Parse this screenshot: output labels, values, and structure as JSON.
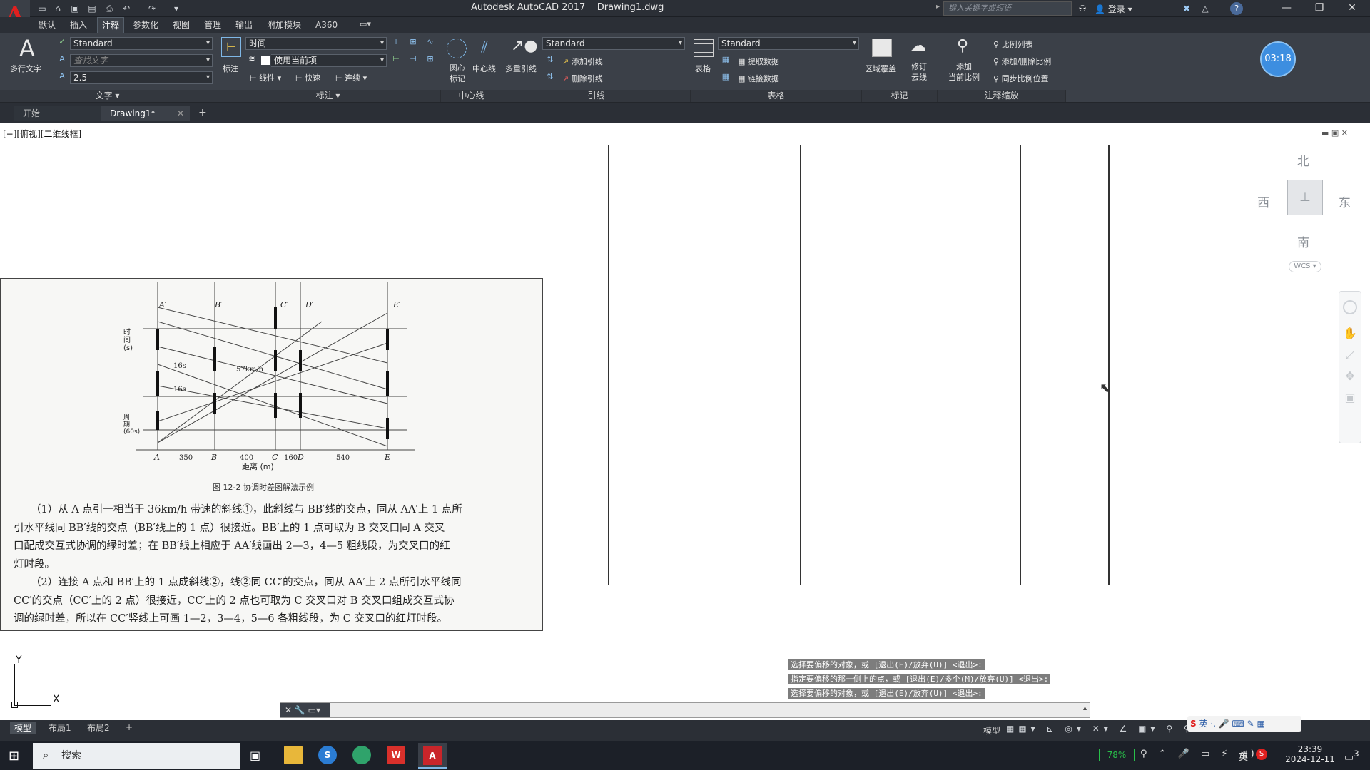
{
  "titlebar": {
    "app_name": "Autodesk AutoCAD 2017",
    "doc_name": "Drawing1.dwg",
    "search_placeholder": "键入关键字或短语",
    "login": "登录"
  },
  "menu_tabs": [
    "默认",
    "插入",
    "注释",
    "参数化",
    "视图",
    "管理",
    "输出",
    "附加模块",
    "A360"
  ],
  "active_menu_tab": "注释",
  "ribbon": {
    "text_panel": {
      "big_button": "多行文字",
      "style": "Standard",
      "find_placeholder": "查找文字",
      "height": "2.5",
      "title": "文字"
    },
    "dim_panel": {
      "big_button": "标注",
      "dim_style": "时间",
      "layer": "使用当前项",
      "linear": "线性",
      "quick": "快速",
      "continue": "连续",
      "title": "标注"
    },
    "centerline_panel": {
      "center_mark": "圆心\n标记",
      "centerline": "中心线",
      "title": "中心线"
    },
    "leader_panel": {
      "big_button": "多重引线",
      "style": "Standard",
      "add": "添加引线",
      "remove": "删除引线",
      "title": "引线"
    },
    "table_panel": {
      "big_button": "表格",
      "style": "Standard",
      "extract": "提取数据",
      "link": "链接数据",
      "title": "表格"
    },
    "markup_panel": {
      "wipeout": "区域覆盖",
      "revcloud": "修订\n云线",
      "title": "标记"
    },
    "scale_panel": {
      "add_scale": "添加\n当前比例",
      "scale_list": "比例列表",
      "add_delete": "添加/删除比例",
      "sync": "同步比例位置",
      "title": "注释缩放"
    },
    "timer": "03:18"
  },
  "doc_tabs": {
    "start": "开始",
    "drawing": "Drawing1*"
  },
  "viewport": {
    "label": "[−][俯视][二维线框]"
  },
  "viewcube": {
    "north": "北",
    "south": "南",
    "east": "东",
    "west": "西",
    "wcs": "WCS"
  },
  "ucs": {
    "x": "X",
    "y": "Y"
  },
  "image_text": {
    "fig_caption": "图 12-2   协调时差图解法示例",
    "y_axis": "时间(s)",
    "x_axis": "距离 (m)",
    "period": "周期(60s)",
    "p1": "（1）从 A 点引一相当于 36km/h 带速的斜线①，此斜线与 BB′线的交点，同从 AA′上 1 点所",
    "p2": "引水平线同 BB′线的交点（BB′线上的 1 点）很接近。BB′上的 1 点可取为 B 交叉口同 A 交叉",
    "p3": "口配成交互式协调的绿时差；在 BB′线上相应于 AA′线画出 2—3，4—5 粗线段，为交叉口的红",
    "p4": "灯时段。",
    "p5": "（2）连接 A 点和 BB′上的 1 点成斜线②，线②同 CC′的交点，同从 AA′上 2 点所引水平线同",
    "p6": "CC′的交点（CC′上的 2 点）很接近，CC′上的 2 点也可取为 C 交叉口对 B 交叉口组成交互式协",
    "p7": "调的绿时差，所以在 CC′竖线上可画 1—2，3—4，5—6 各粗线段，为 C 交叉口的红灯时段。",
    "col_labels_top": [
      "A′",
      "B′",
      "C′",
      "D′",
      "E′"
    ],
    "col_labels_bottom": [
      "A",
      "B",
      "C",
      "D",
      "E"
    ],
    "distances": [
      "350",
      "400",
      "160",
      "540"
    ],
    "speed": "57km/h",
    "t16a": "16s",
    "t16b": "16s"
  },
  "command": {
    "line1": "选择要偏移的对象，或 [退出(E)/放弃(U)] <退出>:",
    "line2": "指定要偏移的那一侧上的点，或 [退出(E)/多个(M)/放弃(U)] <退出>:",
    "line3": "选择要偏移的对象，或 [退出(E)/放弃(U)] <退出>:"
  },
  "layout_tabs": [
    "模型",
    "布局1",
    "布局2"
  ],
  "status": {
    "model": "模型"
  },
  "taskbar": {
    "search": "搜索",
    "battery": "78%",
    "ime": "英",
    "time": "23:39",
    "date": "2024-12-11",
    "notif": "3"
  }
}
